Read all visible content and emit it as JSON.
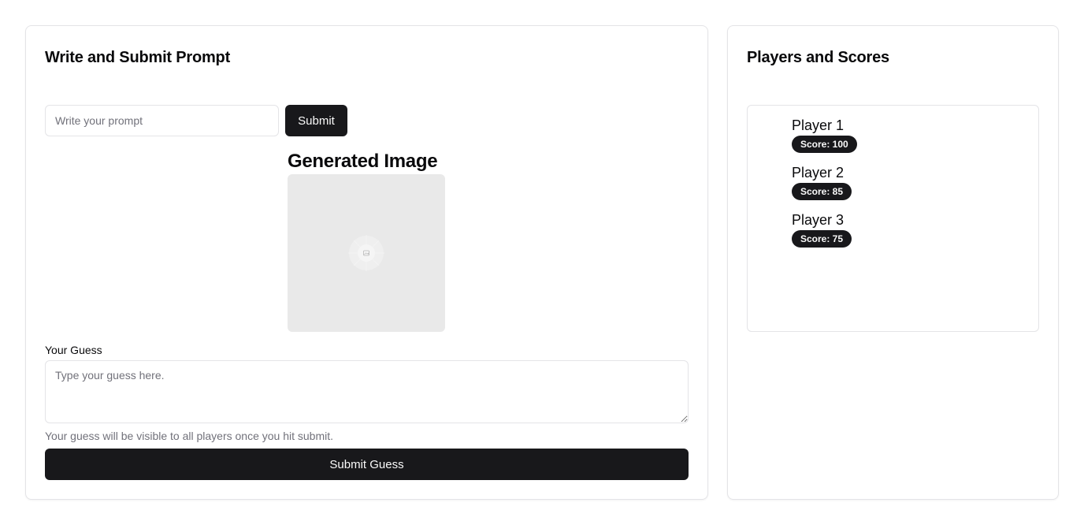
{
  "left_card": {
    "title": "Write and Submit Prompt",
    "prompt_placeholder": "Write your prompt",
    "submit_label": "Submit",
    "generated_title": "Generated Image",
    "guess_label": "Your Guess",
    "guess_placeholder": "Type your guess here.",
    "guess_hint": "Your guess will be visible to all players once you hit submit.",
    "guess_submit_label": "Submit Guess"
  },
  "right_card": {
    "title": "Players and Scores",
    "players": [
      {
        "name": "Player 1",
        "score": "Score: 100"
      },
      {
        "name": "Player 2",
        "score": "Score: 85"
      },
      {
        "name": "Player 3",
        "score": "Score: 75"
      }
    ]
  },
  "colors": {
    "primary_dark": "#18181b",
    "border": "#e4e4e7",
    "muted_text": "#71717a",
    "image_placeholder": "#e9e9e9"
  },
  "icons": {
    "image_placeholder": "image-placeholder-icon"
  }
}
